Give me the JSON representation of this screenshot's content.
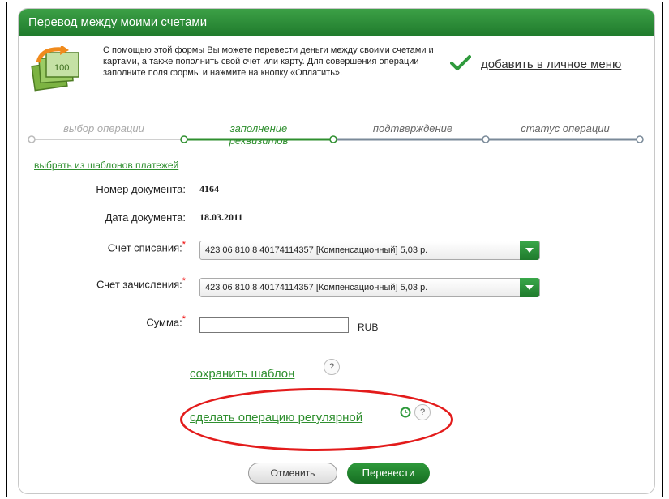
{
  "header": {
    "title": "Перевод между моими счетами"
  },
  "intro": {
    "text": "С помощью этой формы Вы можете перевести деньги между своими счетами и картами, а также пополнить свой счет или карту. Для совершения операции заполните поля формы и нажмите на кнопку «Оплатить»."
  },
  "add_to_menu": {
    "label": "добавить в личное меню"
  },
  "steps": [
    {
      "label": "выбор операции",
      "state": "done"
    },
    {
      "label": "заполнение реквизитов",
      "state": "active"
    },
    {
      "label": "подтверждение",
      "state": "pending"
    },
    {
      "label": "статус операции",
      "state": "pending"
    }
  ],
  "templates_link": {
    "label": "выбрать из шаблонов платежей"
  },
  "form": {
    "doc_number": {
      "label": "Номер документа:",
      "value": "4164"
    },
    "doc_date": {
      "label": "Дата документа:",
      "value": "18.03.2011"
    },
    "from_account": {
      "label": "Счет списания:",
      "required": "*",
      "value": "423 06 810 8 40174114357  [Компенсационный] 5,03  р."
    },
    "to_account": {
      "label": "Счет зачисления:",
      "required": "*",
      "value": "423 06 810 8 40174114357  [Компенсационный] 5,03  р."
    },
    "amount": {
      "label": "Сумма:",
      "required": "*",
      "value": "",
      "currency": "RUB"
    }
  },
  "save_template": {
    "label": "сохранить шаблон",
    "help": "?"
  },
  "regular_operation": {
    "label": "сделать операцию регулярной",
    "help": "?"
  },
  "buttons": {
    "cancel": "Отменить",
    "submit": "Перевести"
  },
  "colors": {
    "brand_green": "#1f7a2c",
    "link_green": "#2f8f2f",
    "highlight_red": "#e31b1b"
  }
}
